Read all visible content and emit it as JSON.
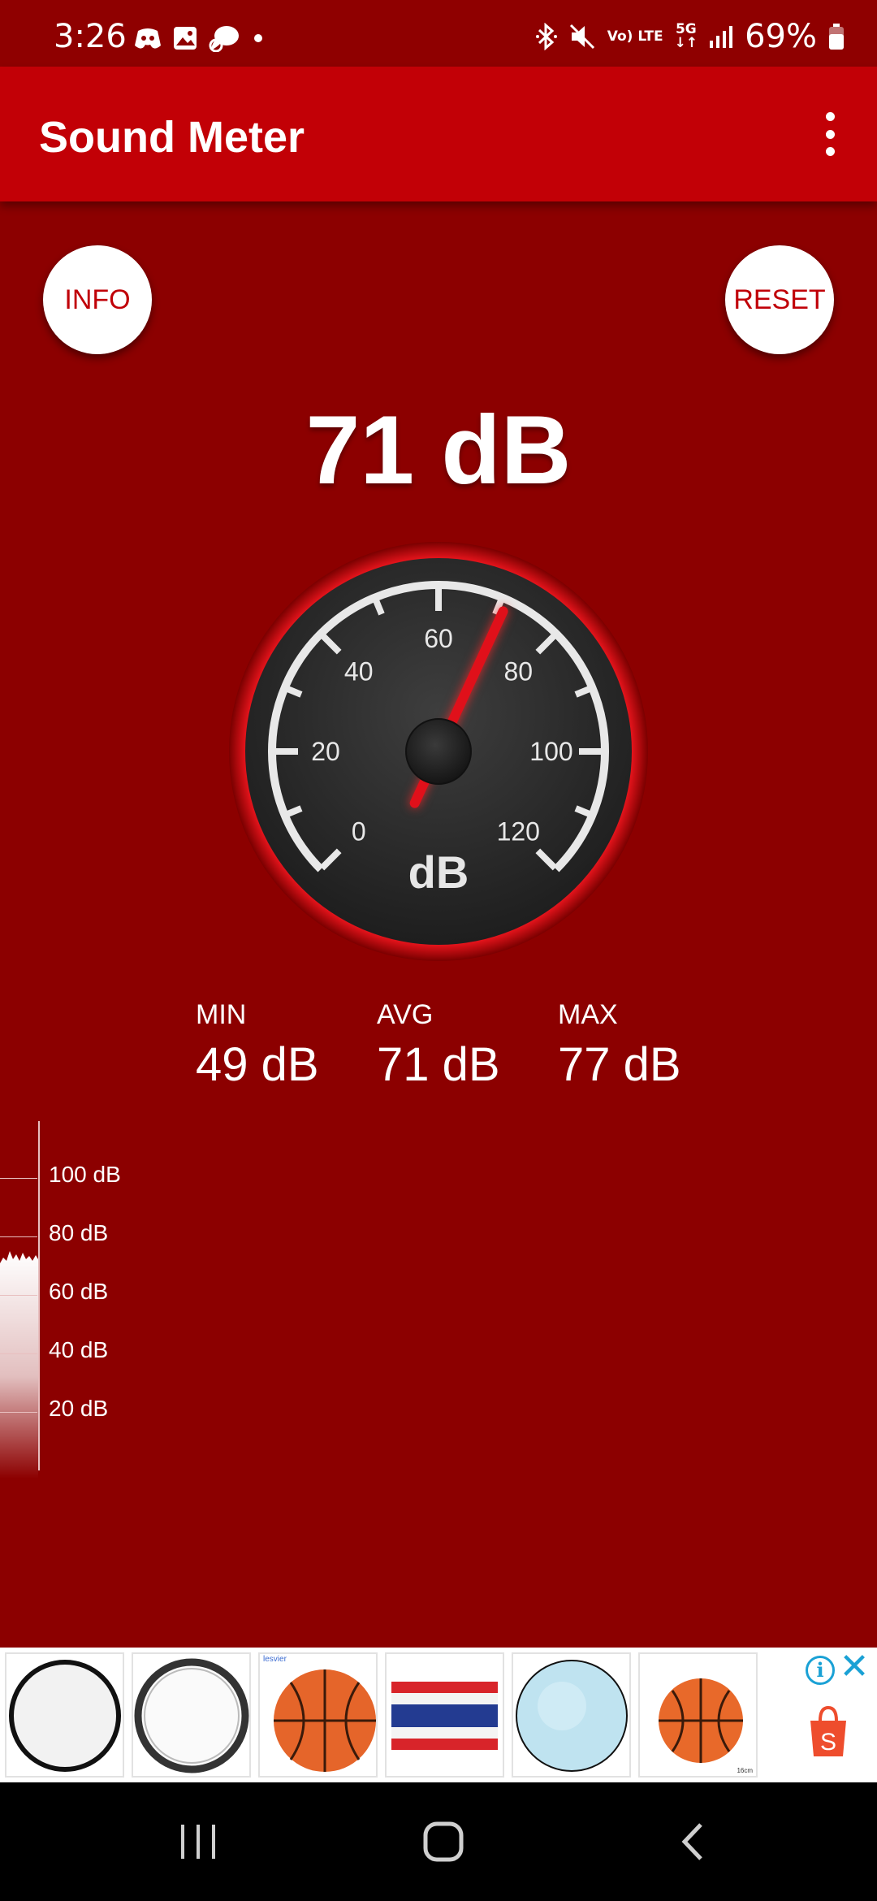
{
  "status_bar": {
    "time": "3:26",
    "battery": "69%",
    "network": "5G",
    "volte": "Vo) LTE",
    "left_icons": [
      "discord-icon",
      "gallery-icon",
      "chat-bubble-icon",
      "dot-icon"
    ],
    "right_icons": [
      "bluetooth-icon",
      "mute-icon",
      "volte-icon",
      "5g-icon",
      "signal-icon",
      "battery-icon"
    ]
  },
  "app_bar": {
    "title": "Sound Meter",
    "menu_icon": "more-vert-icon"
  },
  "buttons": {
    "info": "INFO",
    "reset": "RESET"
  },
  "reading": "71 dB",
  "gauge": {
    "unit": "dB",
    "value": 71,
    "min": 0,
    "max": 120,
    "tick_labels": [
      "0",
      "20",
      "40",
      "60",
      "80",
      "100",
      "120"
    ],
    "accent": "#e0101a"
  },
  "stats": {
    "min_label": "MIN",
    "min_value": "49 dB",
    "avg_label": "AVG",
    "avg_value": "71 dB",
    "max_label": "MAX",
    "max_value": "77 dB"
  },
  "history": {
    "labels": [
      "100 dB",
      "80 dB",
      "60 dB",
      "40 dB",
      "20 dB"
    ]
  },
  "ad": {
    "items": [
      {
        "name": "white-round-plate",
        "brand": "",
        "size": ""
      },
      {
        "name": "white-round-tray",
        "brand": "",
        "size": ""
      },
      {
        "name": "basketball-toy",
        "brand": "lesvier",
        "size": ""
      },
      {
        "name": "thailand-flag",
        "brand": "",
        "size": ""
      },
      {
        "name": "light-blue-disc",
        "brand": "",
        "size": ""
      },
      {
        "name": "basketball-ball",
        "brand": "",
        "size": "16cm"
      }
    ],
    "info_icon": "info-icon",
    "close_icon": "close-icon",
    "shop_icon": "shopping-bag-icon",
    "shop_letter": "S"
  },
  "nav_bar": {
    "buttons": [
      "recents-icon",
      "home-icon",
      "back-icon"
    ]
  },
  "colors": {
    "background": "#8c0000",
    "app_bar": "#c20006",
    "button_text": "#c00008"
  }
}
